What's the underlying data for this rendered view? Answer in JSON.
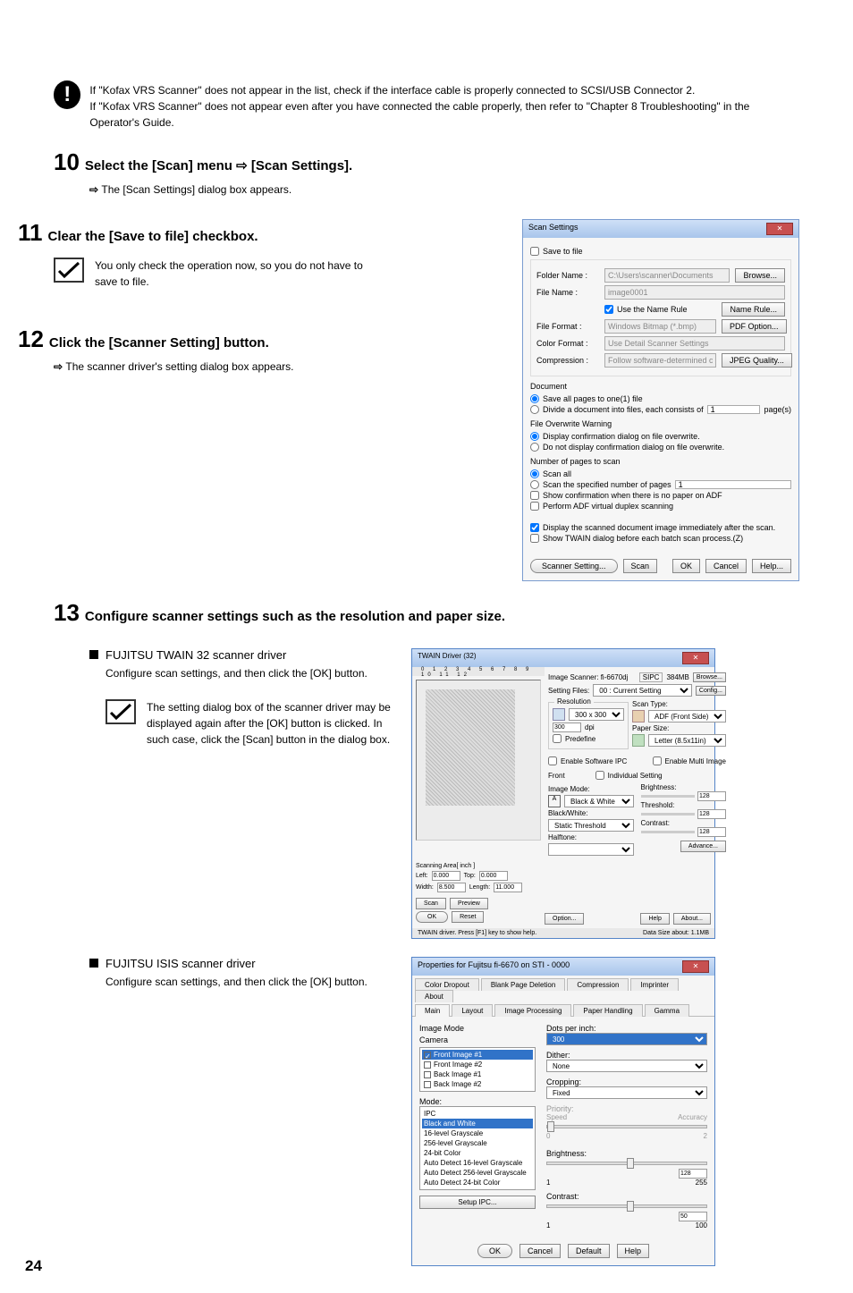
{
  "info1": {
    "line1": "If \"Kofax VRS Scanner\" does not appear in the list, check if the interface cable is properly connected to SCSI/USB Connector 2.",
    "line2": "If \"Kofax VRS Scanner\" does not appear even after you have connected the cable properly, then refer to \"Chapter 8 Troubleshooting\" in the Operator's Guide."
  },
  "step10": {
    "num": "10",
    "title": "Select the [Scan] menu ⇨ [Scan Settings].",
    "result": "The [Scan Settings] dialog box appears."
  },
  "step11": {
    "num": "11",
    "title": "Clear the [Save to file] checkbox.",
    "note": "You only check the operation now, so you do not have to save to file."
  },
  "step12": {
    "num": "12",
    "title": "Click the [Scanner Setting] button.",
    "result": "The scanner driver's setting dialog box appears."
  },
  "step13": {
    "num": "13",
    "title": "Configure scanner settings such as the resolution and paper size."
  },
  "scanSettings": {
    "title": "Scan Settings",
    "saveToFile": "Save to file",
    "folderName": "Folder Name :",
    "folderVal": "C:\\Users\\scanner\\Documents",
    "browse": "Browse...",
    "fileName": "File Name :",
    "fileVal": "image0001",
    "useNameRule": "Use the Name Rule",
    "nameRule": "Name Rule...",
    "fileFormat": "File Format :",
    "fileFormatVal": "Windows Bitmap (*.bmp)",
    "pdfOption": "PDF Option...",
    "colorFormat": "Color Format :",
    "colorFormatVal": "Use Detail Scanner Settings",
    "compression": "Compression :",
    "compressionVal": "Follow software-determined compression fo",
    "jpegQuality": "JPEG Quality...",
    "document": "Document",
    "saveAll": "Save all pages to one(1) file",
    "divide": "Divide a document into files, each consists of",
    "page": "page(s)",
    "overwriteWarning": "File Overwrite Warning",
    "displayConf": "Display confirmation dialog on file overwrite.",
    "doNotDisplay": "Do not display confirmation dialog on file overwrite.",
    "numPages": "Number of pages to scan",
    "scanAll": "Scan all",
    "scanSpec": "Scan the specified number of pages",
    "showConf": "Show confirmation when there is no paper on ADF",
    "perform": "Perform ADF virtual duplex scanning",
    "displayScanned": "Display the scanned document image immediately after the scan.",
    "showTwain": "Show TWAIN dialog before each batch scan process.(Z)",
    "scannerSetting": "Scanner Setting...",
    "scan": "Scan",
    "ok": "OK",
    "cancel": "Cancel",
    "help": "Help..."
  },
  "twainDriver": {
    "header": "FUJITSU TWAIN 32 scanner driver",
    "desc": "Configure scan settings, and then click the [OK] button.",
    "note": "The setting dialog box of the scanner driver may be displayed again after the [OK] button is clicked. In such case, click the [Scan] button in the dialog box.",
    "title": "TWAIN Driver (32)",
    "imageScanner": "Image Scanner: fi-6670dj",
    "sipc": "SIPC",
    "mb": "384MB",
    "browse": "Browse...",
    "settingFiles": "Setting Files:",
    "currentSetting": "00 : Current Setting",
    "config": "Config...",
    "resolution": "Resolution",
    "res300": "300 x 300",
    "dpi": "dpi",
    "predefine": "Predefine",
    "scanType": "Scan Type:",
    "adf": "ADF (Front Side)",
    "paperSize": "Paper Size:",
    "letter": "Letter (8.5x11in)",
    "enableSoft": "Enable Software IPC",
    "enableMulti": "Enable Multi Image",
    "front": "Front",
    "individual": "Individual Setting",
    "imageMode": "Image Mode:",
    "blackWhite": "Black & White",
    "brightness": "Brightness:",
    "blackWhite2": "Black/White:",
    "staticThresh": "Static Threshold",
    "threshold": "Threshold:",
    "halftone": "Halftone:",
    "contrast": "Contrast:",
    "val128": "128",
    "scanArea": "Scanning Area[ inch ]",
    "left": "Left:",
    "top": "Top:",
    "width": "Width:",
    "length": "Length:",
    "v0": "0.000",
    "v85": "8.500",
    "v11": "11.000",
    "scanBtn": "Scan",
    "preview": "Preview",
    "okBtn": "OK",
    "reset": "Reset",
    "option": "Option...",
    "helpBtn": "Help",
    "about": "About...",
    "advance": "Advance...",
    "statusBar": "TWAIN driver. Press [F1] key to show help.",
    "dataSize": "Data Size about:",
    "sizeMB": "1.1MB"
  },
  "isisDriver": {
    "header": "FUJITSU ISIS scanner driver",
    "desc": "Configure scan settings, and then click the [OK] button.",
    "title": "Properties for Fujitsu fi-6670 on STI - 0000",
    "tabs": {
      "colorDropout": "Color Dropout",
      "blankPage": "Blank Page Deletion",
      "compression": "Compression",
      "imprinter": "Imprinter",
      "about": "About",
      "main": "Main",
      "layout": "Layout",
      "imageProc": "Image Processing",
      "paperHandling": "Paper Handling",
      "gamma": "Gamma"
    },
    "imageMode": "Image Mode",
    "camera": "Camera",
    "front1": "Front Image #1",
    "front2": "Front Image #2",
    "back1": "Back Image #1",
    "back2": "Back Image #2",
    "mode": "Mode:",
    "ipc": "IPC",
    "bw": "Black and White",
    "g16": "16-level Grayscale",
    "g256": "256-level Grayscale",
    "c24": "24-bit Color",
    "auto16": "Auto Detect 16-level Grayscale",
    "auto256": "Auto Detect 256-level Grayscale",
    "auto24": "Auto Detect 24-bit Color",
    "setupIPC": "Setup IPC...",
    "dpi": "Dots per inch:",
    "dpi300": "300",
    "dither": "Dither:",
    "none": "None",
    "cropping": "Cropping:",
    "fixed": "Fixed",
    "priority": "Priority:",
    "speed": "Speed",
    "accuracy": "Accuracy",
    "brightness": "Brightness:",
    "contrast": "Contrast:",
    "b1": "1",
    "b255": "255",
    "b128": "128",
    "c100": "100",
    "c50": "50",
    "ok": "OK",
    "cancel": "Cancel",
    "default": "Default",
    "help": "Help"
  },
  "pageNum": "24"
}
